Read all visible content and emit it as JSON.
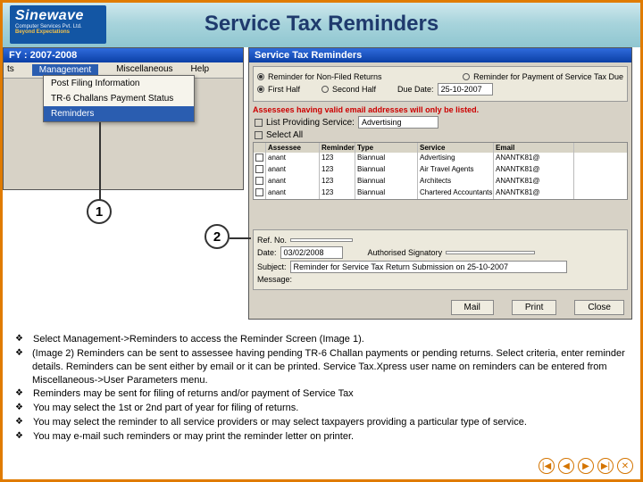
{
  "header": {
    "logo_brand": "Sinewave",
    "logo_line2": "Computer Services Pvt. Ltd.",
    "logo_line3": "Beyond Expectations",
    "title": "Service Tax Reminders"
  },
  "window1": {
    "title": "FY : 2007-2008",
    "menu": {
      "cut_left": "ts",
      "item1": "Management",
      "item2": "Miscellaneous",
      "item3": "Help"
    },
    "dropdown": {
      "item1": "Post Filing Information",
      "item2": "TR-6 Challans Payment Status",
      "item3": "Reminders"
    }
  },
  "window2": {
    "title": "Service Tax Reminders",
    "opt_return_nonfiled": "Reminder for Non-Filed Returns",
    "opt_payment_due": "Reminder for Payment of Service Tax Due",
    "half1": "First Half",
    "half2": "Second Half",
    "due_label": "Due Date:",
    "due_value": "25-10-2007",
    "redline": "Assessees having valid email addresses will only be listed.",
    "list_label": "List Providing Service:",
    "list_value": "Advertising",
    "select_all": "Select All",
    "cols": {
      "assessee": "Assessee",
      "reminder": "Reminder",
      "type": "Type",
      "service": "Service",
      "email": "Email"
    },
    "rows": [
      {
        "a": "anant",
        "r": "123",
        "t": "Biannual",
        "s": "Advertising",
        "e": "ANANTK81@"
      },
      {
        "a": "anant",
        "r": "123",
        "t": "Biannual",
        "s": "Air Travel Agents",
        "e": "ANANTK81@"
      },
      {
        "a": "anant",
        "r": "123",
        "t": "Biannual",
        "s": "Architects",
        "e": "ANANTK81@"
      },
      {
        "a": "anant",
        "r": "123",
        "t": "Biannual",
        "s": "Chartered Accountants",
        "e": "ANANTK81@"
      }
    ],
    "ref_label": "Ref. No.",
    "date_label": "Date:",
    "date_value": "03/02/2008",
    "sig_label": "Authorised Signatory",
    "subj_label": "Subject:",
    "subj_value": "Reminder for Service Tax Return Submission on 25-10-2007",
    "msg_label": "Message:",
    "btn_mail": "Mail",
    "btn_print": "Print",
    "btn_close": "Close"
  },
  "callouts": {
    "one": "1",
    "two": "2"
  },
  "bullets": {
    "b1": "Select Management->Reminders to access the Reminder Screen (Image 1).",
    "b2": "(Image 2) Reminders can be sent to assessee having pending TR-6 Challan payments or pending returns. Select criteria, enter reminder details. Reminders can be sent either by email or it can be printed. Service Tax.Xpress user name on reminders can be entered from Miscellaneous->User Parameters menu.",
    "b3": "Reminders may be sent for filing of returns and/or payment of Service Tax",
    "b4": "You may select the 1st or 2nd part of year for filing of returns.",
    "b5": "You may select the reminder to all service providers or may select taxpayers providing a particular type of service.",
    "b6": "You may e-mail such reminders or may print the reminder letter on printer."
  },
  "nav": {
    "first": "|◀",
    "prev": "◀",
    "next": "▶",
    "last": "▶|",
    "close": "✕"
  }
}
